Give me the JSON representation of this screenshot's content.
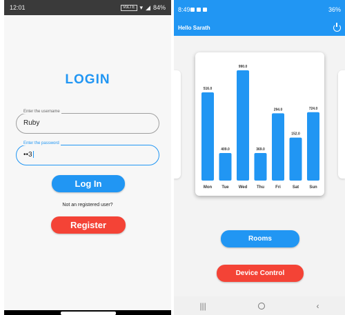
{
  "left_phone": {
    "status_bar": {
      "time": "12:01",
      "right_text": "84%",
      "volte_badge": "VoLTE"
    },
    "title": "LOGIN",
    "username": {
      "label": "Enter the username",
      "value": "Ruby"
    },
    "password": {
      "label": "Enter the password",
      "value": "••3"
    },
    "login_button": "Log In",
    "not_registered_text": "Not an registered user?",
    "register_button": "Register"
  },
  "right_phone": {
    "status_bar": {
      "time": "8:49",
      "right_text": "36%"
    },
    "app_bar": {
      "title": "Hello Sarath",
      "power_icon": "power-icon"
    },
    "rooms_button": "Rooms",
    "device_control_button": "Device Control"
  },
  "chart_data": {
    "type": "bar",
    "categories": [
      "Mon",
      "Tue",
      "Wed",
      "Thu",
      "Fri",
      "Sat",
      "Sun"
    ],
    "values": [
      516.0,
      409.0,
      990.0,
      369.0,
      294.0,
      152.0,
      724.0
    ],
    "value_labels": [
      "516.0",
      "409.0",
      "990.0",
      "369.0",
      "294.0",
      "152.0",
      "724.0"
    ],
    "bar_heights_relative": [
      0.8,
      0.25,
      1.0,
      0.25,
      0.61,
      0.39,
      0.62
    ],
    "bar_color": "#2196f3",
    "title": "",
    "xlabel": "",
    "ylabel": ""
  },
  "colors": {
    "primary": "#2196f3",
    "danger": "#f44336"
  }
}
